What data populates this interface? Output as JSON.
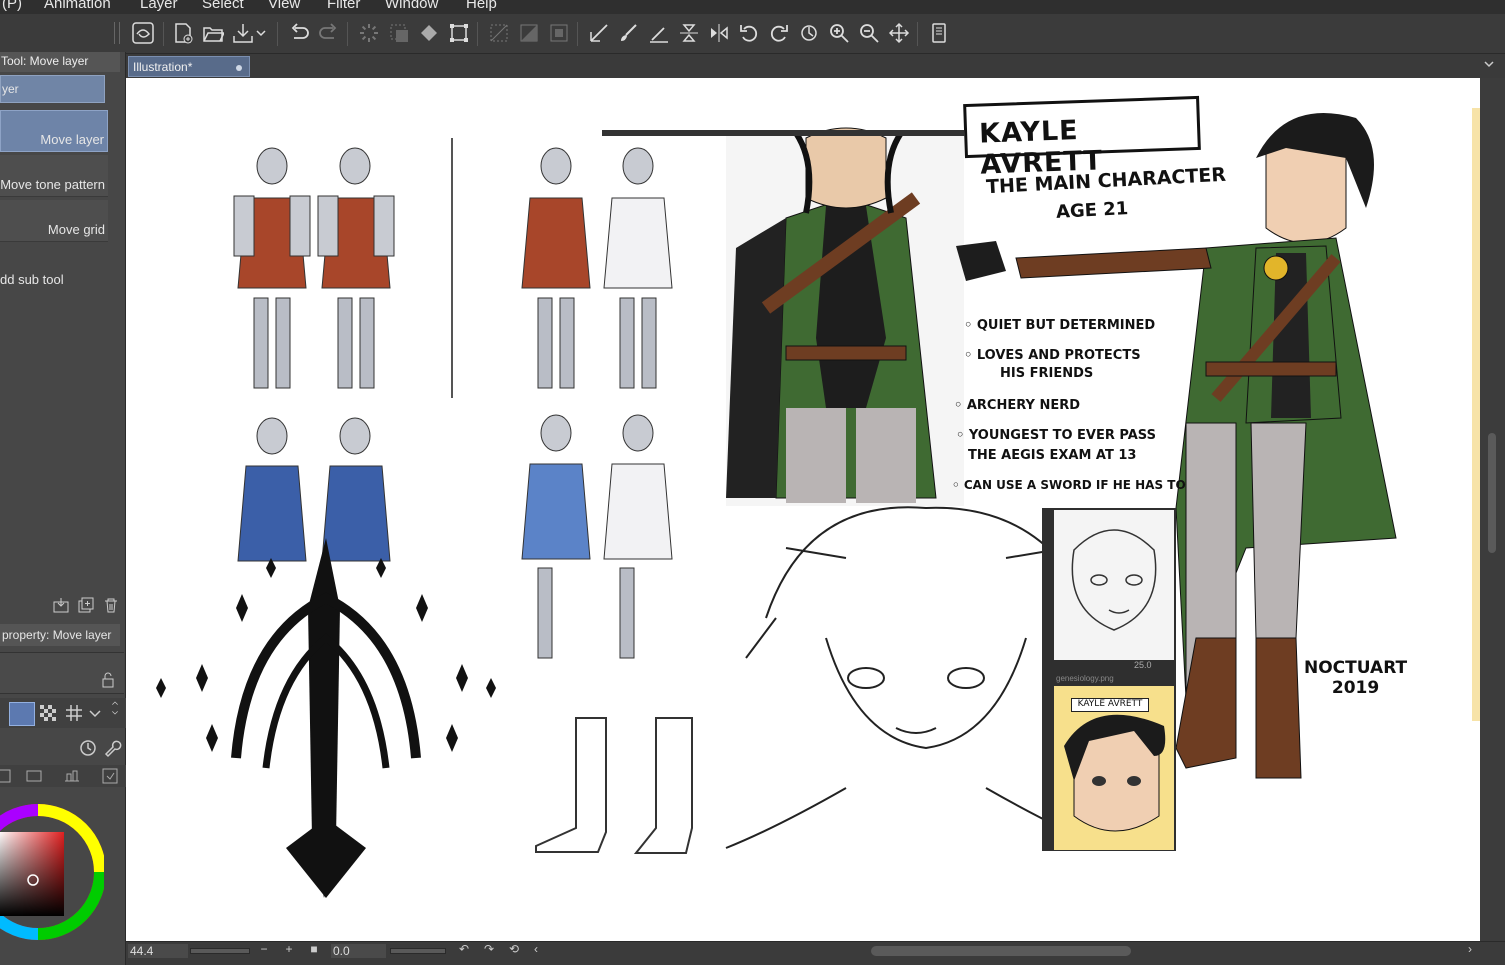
{
  "menu": [
    "(P)",
    "Animation",
    "Layer",
    "Select",
    "View",
    "Filter",
    "Window",
    "Help"
  ],
  "left_panel": {
    "tool_header": "Tool: Move layer",
    "group_label": "yer",
    "subtools": [
      "Move layer",
      "Move tone pattern",
      "Move grid"
    ],
    "add_sub_tool": "dd sub tool",
    "property_header": "property: Move layer"
  },
  "document": {
    "tab_label": "Illustration*"
  },
  "status": {
    "zoom": "44.4",
    "angle": "0.0"
  },
  "artwork": {
    "title": "KAYLE AVRETT",
    "subtitle": "THE MAIN CHARACTER",
    "age": "AGE 21",
    "traits": [
      "QUIET BUT DETERMINED",
      "LOVES AND PROTECTS",
      "HIS FRIENDS",
      "ARCHERY NERD",
      "YOUNGEST TO EVER PASS",
      "THE AEGIS EXAM AT 13",
      "CAN USE A SWORD IF HE HAS TO"
    ],
    "signature": "NOCTUART",
    "signature_year": "2019",
    "ref_label": "KAYLE AVRETT",
    "ref_zoom": "25.0",
    "ref_name": "genesiology.png"
  },
  "colors": {
    "accent_tab": "#586b8a",
    "active_tool": "#6e84a8",
    "yellow_card": "#f7e3a8",
    "cloak_green": "#3f6a32",
    "armor_red": "#a8462a",
    "armor_blue": "#3b5fa8"
  }
}
